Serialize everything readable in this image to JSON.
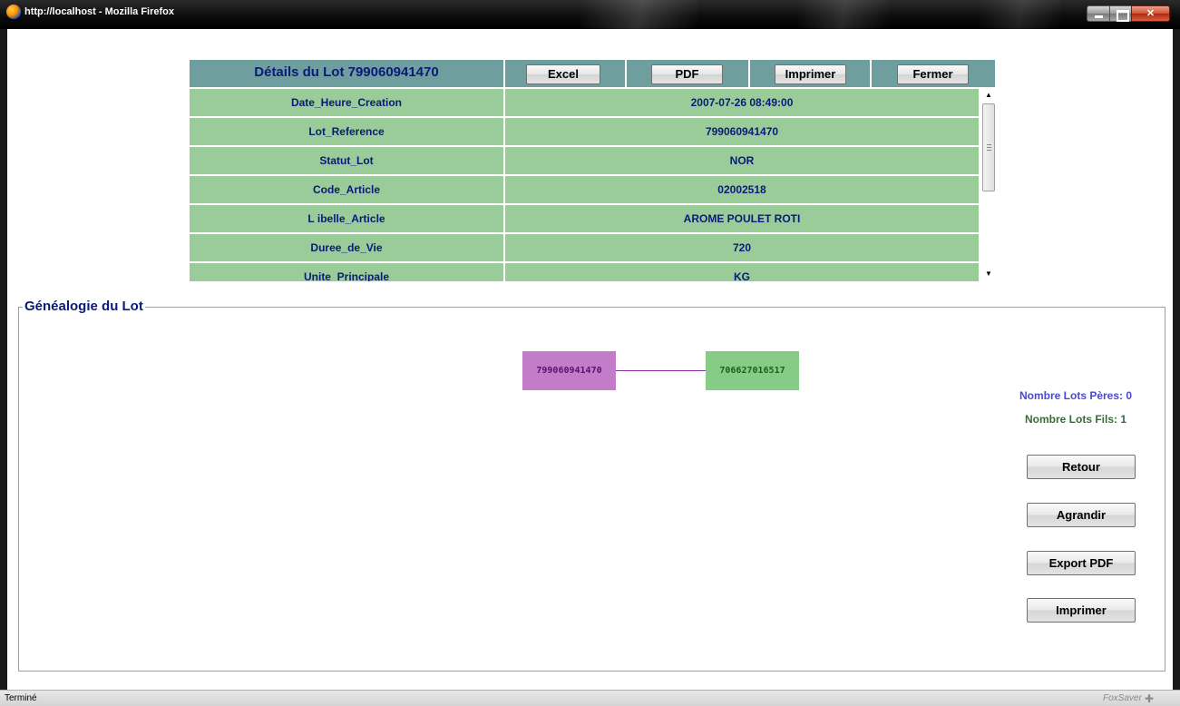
{
  "window": {
    "title": "http://localhost - Mozilla Firefox"
  },
  "detail": {
    "title": "Détails du Lot 799060941470",
    "buttons": {
      "excel": "Excel",
      "pdf": "PDF",
      "print": "Imprimer",
      "close": "Fermer"
    },
    "rows": [
      {
        "key": "Date_Heure_Creation",
        "value": "2007-07-26 08:49:00"
      },
      {
        "key": "Lot_Reference",
        "value": "799060941470"
      },
      {
        "key": "Statut_Lot",
        "value": "NOR"
      },
      {
        "key": "Code_Article",
        "value": "02002518"
      },
      {
        "key": "L ibelle_Article",
        "value": "AROME POULET ROTI"
      },
      {
        "key": "Duree_de_Vie",
        "value": "720"
      },
      {
        "key": "Unite_Principale",
        "value": "KG"
      }
    ]
  },
  "genealogy": {
    "legend": "Généalogie du Lot",
    "parent_node": "799060941470",
    "child_node": "706627016517",
    "peres_count": "Nombre Lots Pères: 0",
    "fils_count": "Nombre Lots Fils: 1",
    "buttons": {
      "back": "Retour",
      "enlarge": "Agrandir",
      "export_pdf": "Export PDF",
      "print": "Imprimer"
    },
    "colors": {
      "parent": "#c27cc8",
      "child": "#86cc86",
      "edge": "#8a2aa0"
    }
  },
  "statusbar": {
    "text": "Terminé",
    "addon": "FoxSaver"
  },
  "colors": {
    "header_bg": "#6e9e9e",
    "row_bg": "#99cc99",
    "text_navy": "#0a1a7a"
  }
}
